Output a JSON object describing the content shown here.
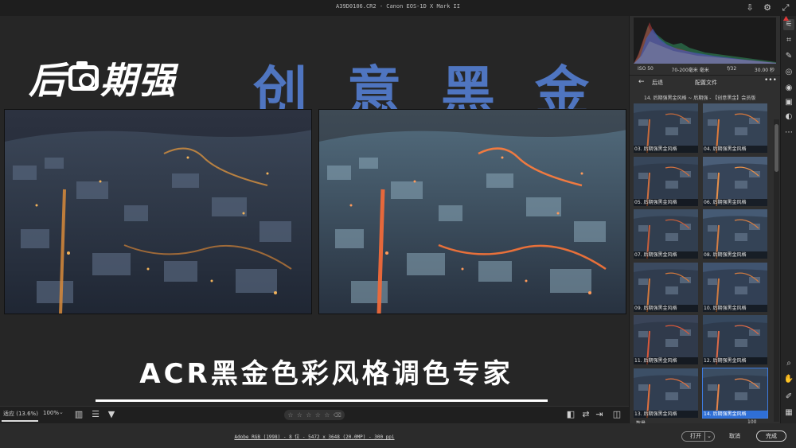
{
  "window": {
    "title": "A39D0106.CR2 -  Canon EOS-1D X Mark II",
    "export_icon": "export-icon",
    "settings_icon": "gear-icon"
  },
  "brand": {
    "logo_text_left": "后",
    "logo_text_right": "期强",
    "title": "创意黑金"
  },
  "slogan": "ACR黑金色彩风格调色专家",
  "compare": {
    "before_label": "before-photo",
    "after_label": "after-photo"
  },
  "toolbar": {
    "zoom_fit": "适应 (13.6%)",
    "zoom_percent": "100%",
    "zoom_caret": "⌄",
    "rating_stars": [
      "☆",
      "☆",
      "☆",
      "☆",
      "☆"
    ],
    "rating_trash": "🗑",
    "icons_left": [
      "filmstrip-icon",
      "sort-icon",
      "filter-icon"
    ],
    "icons_right": [
      "before-after-icon",
      "swap-icon",
      "copy-settings-icon",
      "view-mode-icon"
    ]
  },
  "status": {
    "workflow_info": "Adobe RGB (1998) - 8 位 - 5472 x 3648 (20.0MP) - 300 ppi"
  },
  "histogram": {
    "iso": "ISO 50",
    "lens": "70-200毫米 毫米",
    "aperture": "f/32",
    "shutter": "30.00 秒"
  },
  "panel": {
    "back_label": "后退",
    "title": "配置文件",
    "more": "•••",
    "breadcrumb": "14. 后期强黑金风格 ~ 后期强 - 【创意黑金】会员版",
    "amount_label": "数量",
    "amount_value": "100",
    "thumbnails": [
      {
        "label": "03. 后期强黑金风格"
      },
      {
        "label": "04. 后期强黑金风格"
      },
      {
        "label": "05. 后期强黑金风格"
      },
      {
        "label": "06. 后期强黑金风格"
      },
      {
        "label": "07. 后期强黑金风格"
      },
      {
        "label": "08. 后期强黑金风格"
      },
      {
        "label": "09. 后期强黑金风格"
      },
      {
        "label": "10. 后期强黑金风格"
      },
      {
        "label": "11. 后期强黑金风格"
      },
      {
        "label": "12. 后期强黑金风格"
      },
      {
        "label": "13. 后期强黑金风格"
      },
      {
        "label": "14. 后期强黑金风格",
        "selected": true
      }
    ]
  },
  "tools": [
    "edit-icon",
    "crop-icon",
    "healing-icon",
    "mask-icon",
    "redeye-icon",
    "presets-icon",
    "snapshots-icon",
    "more-icon",
    "zoom-icon",
    "hand-icon",
    "sampler-icon",
    "grid-icon"
  ],
  "footer": {
    "open": "打开",
    "open_caret": "⌄",
    "cancel": "取消",
    "done": "完成"
  },
  "colors": {
    "accent": "#4f75c0",
    "selection": "#2f6fd6"
  }
}
